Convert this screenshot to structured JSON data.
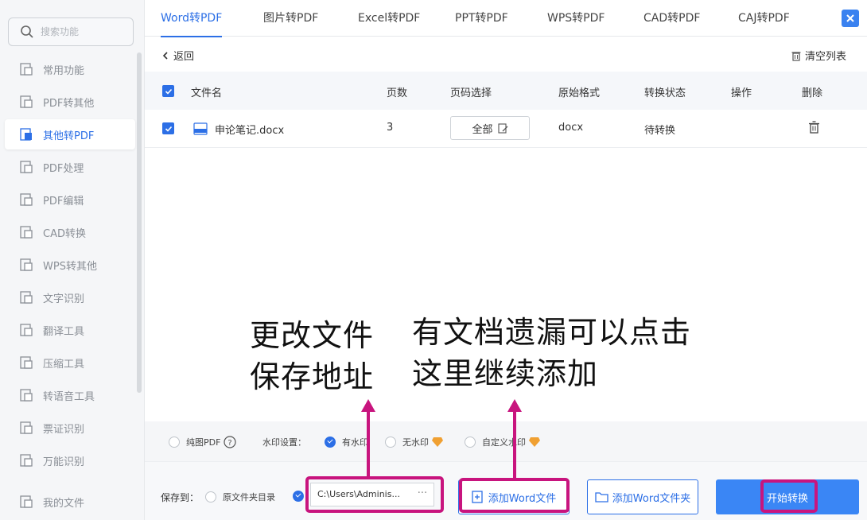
{
  "search": {
    "placeholder": "搜索功能"
  },
  "sidebar": {
    "items": [
      {
        "label": "常用功能"
      },
      {
        "label": "PDF转其他"
      },
      {
        "label": "其他转PDF"
      },
      {
        "label": "PDF处理"
      },
      {
        "label": "PDF编辑"
      },
      {
        "label": "CAD转换"
      },
      {
        "label": "WPS转其他"
      },
      {
        "label": "文字识别"
      },
      {
        "label": "翻译工具"
      },
      {
        "label": "压缩工具"
      },
      {
        "label": "转语音工具"
      },
      {
        "label": "票证识别"
      },
      {
        "label": "万能识别"
      },
      {
        "label": "我的文件"
      }
    ],
    "active_index": 2
  },
  "tabs": [
    {
      "label": "Word转PDF"
    },
    {
      "label": "图片转PDF"
    },
    {
      "label": "Excel转PDF"
    },
    {
      "label": "PPT转PDF"
    },
    {
      "label": "WPS转PDF"
    },
    {
      "label": "CAD转PDF"
    },
    {
      "label": "CAJ转PDF"
    }
  ],
  "toolbar": {
    "back_label": "返回",
    "clear_label": "清空列表"
  },
  "table": {
    "headers": {
      "filename": "文件名",
      "pages": "页数",
      "page_select": "页码选择",
      "format": "原始格式",
      "status": "转换状态",
      "action": "操作",
      "delete": "删除"
    },
    "rows": [
      {
        "filename": "申论笔记.docx",
        "pages": "3",
        "page_select": "全部",
        "format": "docx",
        "status": "待转换"
      }
    ]
  },
  "options": {
    "pure_pdf": "纯图PDF",
    "watermark_label": "水印设置：",
    "watermark_on": "有水印",
    "watermark_off": "无水印",
    "watermark_custom": "自定义水印"
  },
  "save": {
    "label": "保存到：",
    "source_dir": "原文件夹目录",
    "path": "C:\\Users\\Adminis...",
    "dots": "···"
  },
  "buttons": {
    "add_file": "添加Word文件",
    "add_folder": "添加Word文件夹",
    "start": "开始转换"
  },
  "annotations": {
    "left": "更改文件\n保存地址",
    "right": "有文档遗漏可以点击\n这里继续添加"
  },
  "colors": {
    "accent": "#2c6fe6",
    "highlight": "#c8147e",
    "gem": "#f0a032"
  }
}
